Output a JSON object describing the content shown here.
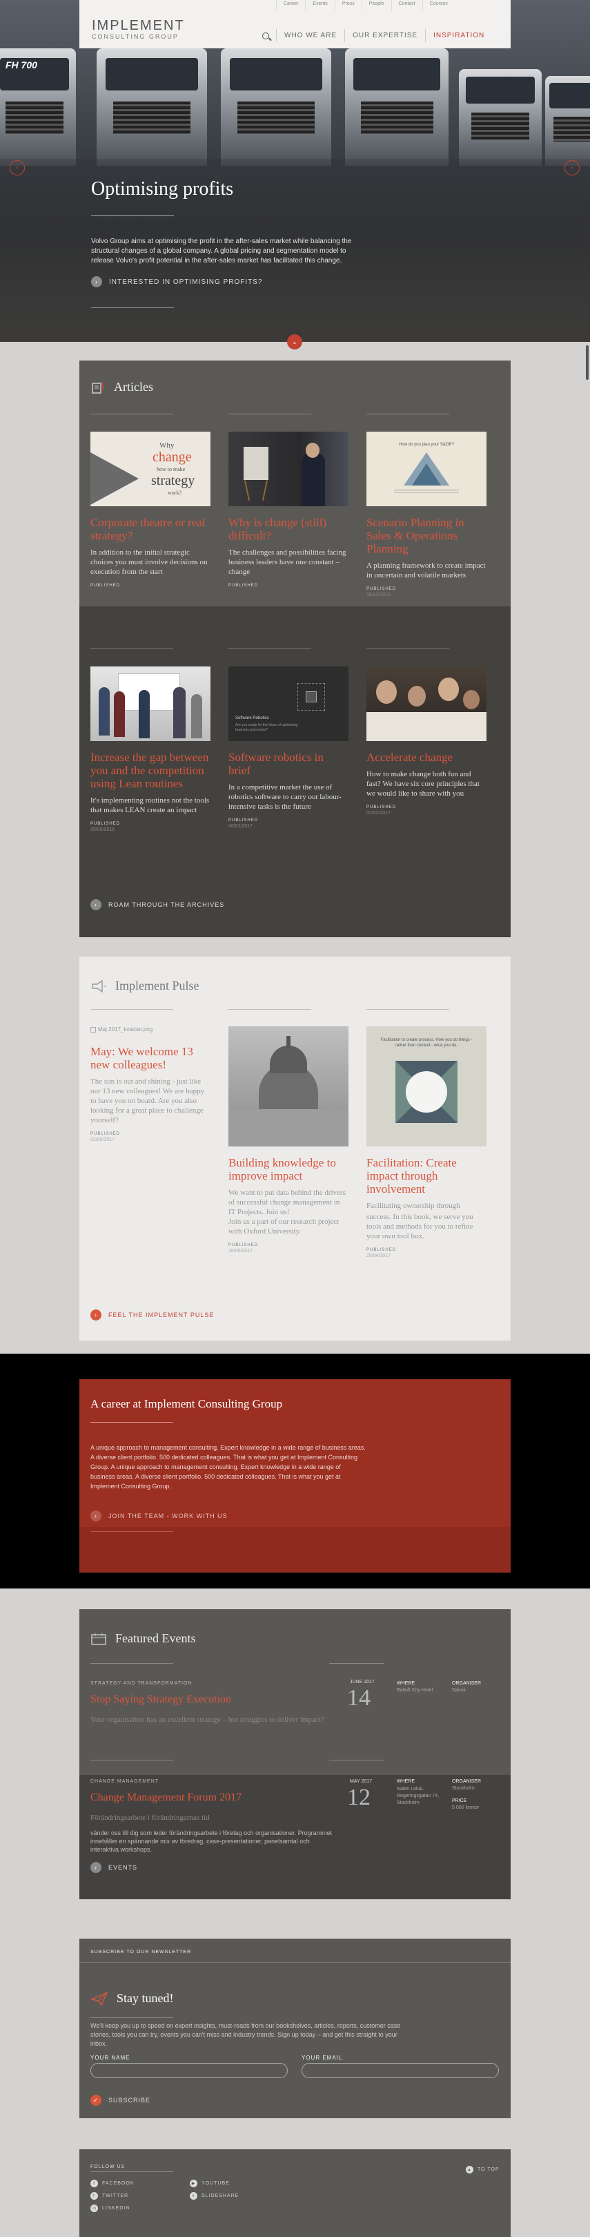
{
  "header": {
    "logo_line1": "IMPLEMENT",
    "logo_line2": "CONSULTING GROUP",
    "top_links": [
      "Career",
      "Events",
      "Press",
      "People",
      "Contact",
      "Courses"
    ],
    "main_nav": [
      "WHO WE ARE",
      "OUR EXPERTISE",
      "INSPIRATION"
    ]
  },
  "hero": {
    "title": "Optimising profits",
    "text": "Volvo Group aims at optimising the profit in the after-sales market while balancing the structural changes of a global company. A global pricing and segmentation model to release Volvo's profit potential in the after-sales market has facilitated this change.",
    "link": "INTERESTED IN OPTIMISING PROFITS?",
    "truck_tag": "FH 700"
  },
  "articles": {
    "title": "Articles",
    "cards": [
      {
        "title": "Corporate theatre or real strategy?",
        "desc": "In addition to the initial strategic choices you must involve decisions on execution from the start",
        "pub": "PUBLISHED",
        "date": "",
        "thumb_text": [
          "Why",
          "change",
          "how to make",
          "strategy",
          "work?"
        ]
      },
      {
        "title": "Why is change (still) difficult?",
        "desc": "The challenges and possibilities facing business leaders have one constant – change",
        "pub": "PUBLISHED",
        "date": ""
      },
      {
        "title": "Scenario Planning in Sales & Operations Planning",
        "desc": "A planning framework to create impact in uncertain and volatile markets",
        "pub": "PUBLISHED",
        "date": "18/12/2015",
        "thumb_text": [
          "How do you plan your S&OP?"
        ]
      },
      {
        "title": "Increase the gap between you and the competition using Lean routines",
        "desc": "It's implementing routines not the tools that makes LEAN create an impact",
        "pub": "PUBLISHED",
        "date": "20/09/2016"
      },
      {
        "title": "Software robotics in brief",
        "desc": "In a competitive market the use of robotics software to carry out labour-intensive tasks is the future",
        "pub": "PUBLISHED",
        "date": "06/02/2017",
        "thumb_text": [
          "Software Robotics",
          "Are you ready for the future of optimizing business processes?"
        ]
      },
      {
        "title": "Accelerate change",
        "desc": "How to make change both fun and fast? We have six core principles that we would like to share with you",
        "pub": "PUBLISHED",
        "date": "02/02/2017"
      }
    ],
    "archive_link": "ROAM THROUGH THE ARCHIVES"
  },
  "pulse": {
    "title": "Implement Pulse",
    "cards": [
      {
        "img_alt": "Maj 2017_kvadrat.png",
        "title": "May: We welcome 13 new colleagues!",
        "desc": "The sun is out and shining - just like our 13 new colleagues! We are happy to have you on board. Are you also looking for a great place to challenge yourself?",
        "pub": "PUBLISHED",
        "date": "02/05/2017"
      },
      {
        "title": "Building knowledge to improve impact",
        "desc1": "We want to put data behind the drivers of successful change management in IT Projects. Join us!",
        "desc2": "Join us a part of our research project with Oxford University.",
        "pub": "PUBLISHED",
        "date": "18/05/2017"
      },
      {
        "title": "Facilitation: Create impact through involvement",
        "desc1": "Facilitating ownership through",
        "desc2": "success. In this book, we serve you tools and methods for you to refine your own tool box.",
        "pub": "PUBLISHED",
        "date": "25/04/2017",
        "thumb_text": "Facilitation to create process. How you do things - rather than content - what you do."
      }
    ],
    "link": "FEEL THE IMPLEMENT PULSE"
  },
  "career": {
    "title": "A career at Implement Consulting Group",
    "text": "A unique approach to management consulting. Expert knowledge in a wide range of business areas. A diverse client portfolio. 500 dedicated colleagues. That is what you get at Implement Consulting Group. A unique approach to management consulting. Expert knowledge in a wide range of business areas. A diverse client portfolio. 500 dedicated colleagues. That is what you get at Implement Consulting Group.",
    "link": "JOIN THE TEAM - WORK WITH US"
  },
  "events": {
    "title": "Featured Events",
    "items": [
      {
        "category": "STRATEGY AND TRANSFORMATION",
        "title": "Stop Saying Strategy Execution",
        "desc": "Your organisation has an excellent strategy – but struggles to deliver impact?",
        "month": "JUNE 2017",
        "day": "14",
        "where_label": "WHERE",
        "where": "Baltoft City Hotel",
        "org_label": "ORGANISER",
        "org": "Dansk"
      },
      {
        "category": "CHANGE MANAGEMENT",
        "title": "Change Management Forum 2017",
        "desc": "Förändringsarbete i förändringarnas tid",
        "desc2": "vänder oss till dig som leder förändringsarbete i företag och organisationer. Programmet innehåller en spännande mix av föredrag, case-presentationer, panelsamtal och interaktiva workshops.",
        "month": "MAY 2017",
        "day": "12",
        "where_label": "WHERE",
        "where": "Nalen Lokal, Regeringsgatan 74, Stockholm",
        "org_label": "ORGANISER",
        "org": "Stockholm",
        "price_label": "PRICE",
        "price": "5 000 kronor"
      }
    ],
    "link": "EVENTS"
  },
  "newsletter": {
    "label": "SUBSCRIBE TO OUR NEWSLETTER",
    "title": "Stay tuned!",
    "text": "We'll keep you up to speed on expert insights, must-reads from our bookshelves, articles, reports, customer case stories, tools you can try, events you can't miss and industry trends. Sign up today – and get this straight to your inbox.",
    "name_label": "YOUR NAME",
    "email_label": "YOUR EMAIL",
    "subscribe": "SUBSCRIBE"
  },
  "footer": {
    "follow": "FOLLOW US",
    "links": [
      "FACEBOOK",
      "TWITTER",
      "LINKEDIN",
      "YOUTUBE",
      "SLIDESHARE"
    ],
    "to_top": "TO TOP"
  }
}
